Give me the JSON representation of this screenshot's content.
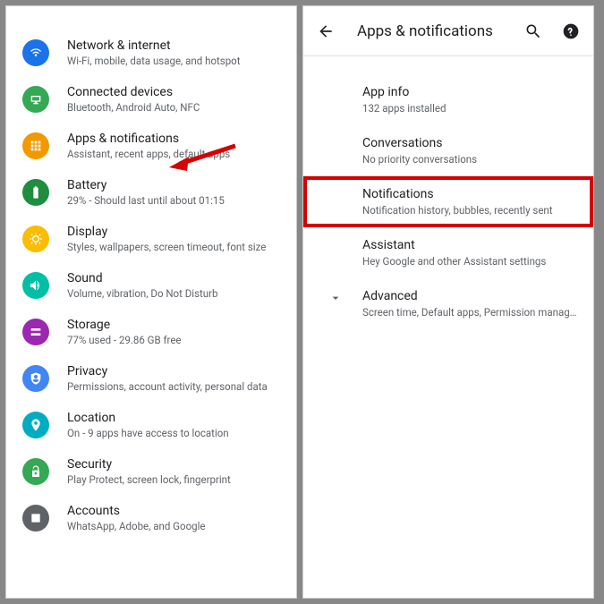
{
  "left": {
    "items": [
      {
        "title": "Network & internet",
        "sub": "Wi-Fi, mobile, data usage, and hotspot",
        "color": "#1a73e8"
      },
      {
        "title": "Connected devices",
        "sub": "Bluetooth, Android Auto, NFC",
        "color": "#34a853"
      },
      {
        "title": "Apps & notifications",
        "sub": "Assistant, recent apps, default apps",
        "color": "#f29900"
      },
      {
        "title": "Battery",
        "sub": "29% - Should last until about 01:15",
        "color": "#1e8e3e"
      },
      {
        "title": "Display",
        "sub": "Styles, wallpapers, screen timeout, font size",
        "color": "#fbbc04"
      },
      {
        "title": "Sound",
        "sub": "Volume, vibration, Do Not Disturb",
        "color": "#00bfa5"
      },
      {
        "title": "Storage",
        "sub": "77% used - 29.86 GB free",
        "color": "#9c27b0"
      },
      {
        "title": "Privacy",
        "sub": "Permissions, account activity, personal data",
        "color": "#4285f4"
      },
      {
        "title": "Location",
        "sub": "On - 9 apps have access to location",
        "color": "#00acc1"
      },
      {
        "title": "Security",
        "sub": "Play Protect, screen lock, fingerprint",
        "color": "#34a853"
      },
      {
        "title": "Accounts",
        "sub": "WhatsApp, Adobe, and Google",
        "color": "#5f6368"
      }
    ]
  },
  "right": {
    "title": "Apps & notifications",
    "items": [
      {
        "title": "App info",
        "sub": "132 apps installed"
      },
      {
        "title": "Conversations",
        "sub": "No priority conversations"
      },
      {
        "title": "Notifications",
        "sub": "Notification history, bubbles, recently sent",
        "highlight": true
      },
      {
        "title": "Assistant",
        "sub": "Hey Google and other Assistant settings"
      },
      {
        "title": "Advanced",
        "sub": "Screen time, Default apps, Permission manager, Wi..",
        "expandable": true
      }
    ]
  },
  "annotations": {
    "arrow_color": "#d60000",
    "highlight_color": "#d60000"
  }
}
